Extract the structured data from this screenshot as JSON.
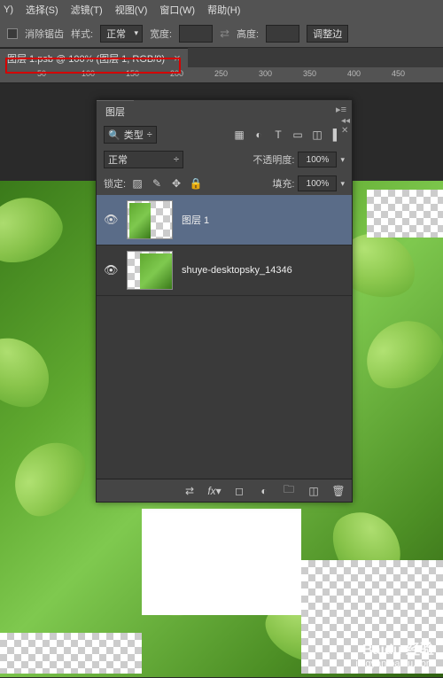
{
  "menu": {
    "items": [
      "Y)",
      "选择(S)",
      "滤镜(T)",
      "视图(V)",
      "窗口(W)",
      "帮助(H)"
    ]
  },
  "toolbar": {
    "antialias": "消除锯齿",
    "style_label": "样式:",
    "style_value": "正常",
    "width_label": "宽度:",
    "height_label": "高度:",
    "adjust_edge": "调整边"
  },
  "document": {
    "tab": "图层 1.psb @ 100% (图层 1, RGB/8)"
  },
  "ruler": {
    "ticks": [
      "50",
      "100",
      "150",
      "200",
      "250",
      "300",
      "350",
      "400",
      "450"
    ]
  },
  "panel": {
    "title": "图层",
    "kind_label": "类型",
    "blend_mode": "正常",
    "opacity_label": "不透明度:",
    "opacity_value": "100%",
    "lock_label": "锁定:",
    "fill_label": "填充:",
    "fill_value": "100%",
    "layers": [
      {
        "name": "图层 1",
        "visible": true,
        "selected": true
      },
      {
        "name": "shuye-desktopsky_14346",
        "visible": true,
        "selected": false
      }
    ]
  },
  "watermark": {
    "brand": "Baidu 经验",
    "url": "jingyan.baidu.com"
  }
}
